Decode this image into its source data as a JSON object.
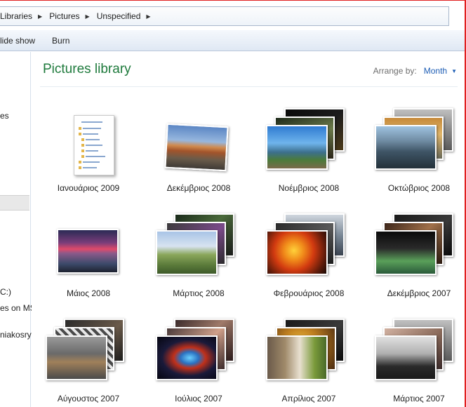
{
  "breadcrumb": {
    "items": [
      "Libraries",
      "Pictures",
      "Unspecified"
    ]
  },
  "toolbar": {
    "slide_show": "lide show",
    "burn": "Burn"
  },
  "nav": {
    "items": [
      "es",
      "C:)",
      "es on MS",
      "niakosryt"
    ]
  },
  "library": {
    "title": "Pictures library",
    "arrange_label": "Arrange by:",
    "arrange_value": "Month"
  },
  "groups": [
    {
      "label": "Ιανουάριος 2009"
    },
    {
      "label": "Δεκέμβριος 2008"
    },
    {
      "label": "Νοέμβριος 2008"
    },
    {
      "label": "Οκτώβριος 2008"
    },
    {
      "label": "Μάιος 2008"
    },
    {
      "label": "Μάρτιος 2008"
    },
    {
      "label": "Φεβρουάριος 2008"
    },
    {
      "label": "Δεκέμβριος 2007"
    },
    {
      "label": "Αύγουστος 2007"
    },
    {
      "label": "Ιούλιος 2007"
    },
    {
      "label": "Απρίλιος 2007"
    },
    {
      "label": "Μάρτιος 2007"
    }
  ]
}
